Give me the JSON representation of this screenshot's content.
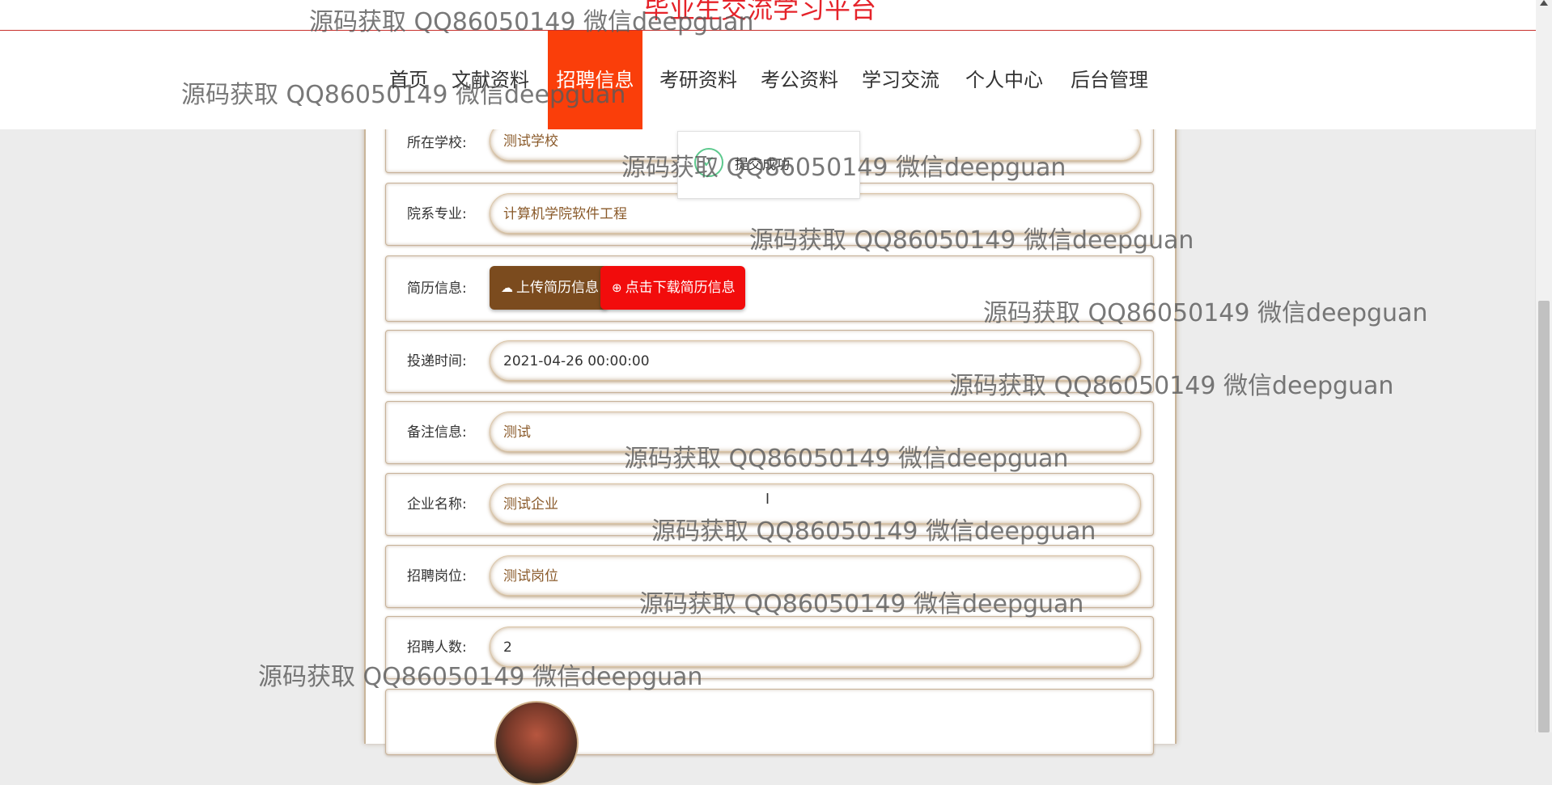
{
  "header": {
    "site_title": "毕业生交流学习平台",
    "nav": [
      {
        "label": "首页",
        "active": false
      },
      {
        "label": "文献资料",
        "active": false
      },
      {
        "label": "招聘信息",
        "active": true
      },
      {
        "label": "考研资料",
        "active": false
      },
      {
        "label": "考公资料",
        "active": false
      },
      {
        "label": "学习交流",
        "active": false
      },
      {
        "label": "个人中心",
        "active": false
      },
      {
        "label": "后台管理",
        "active": false
      }
    ],
    "accent_color": "#fa3e0a"
  },
  "form": {
    "school": {
      "label": "所在学校:",
      "value": "测试学校"
    },
    "major": {
      "label": "院系专业:",
      "value": "计算机学院软件工程"
    },
    "resume": {
      "label": "简历信息:",
      "upload_label": "上传简历信息",
      "download_label": "点击下载简历信息"
    },
    "submit_time": {
      "label": "投递时间:",
      "value": "2021-04-26 00:00:00"
    },
    "remark": {
      "label": "备注信息:",
      "value": "测试"
    },
    "company": {
      "label": "企业名称:",
      "value": "测试企业"
    },
    "position": {
      "label": "招聘岗位:",
      "value": "测试岗位"
    },
    "headcount": {
      "label": "招聘人数:",
      "value": "2"
    }
  },
  "toast": {
    "message": "提交成功",
    "icon": "check-circle-icon"
  },
  "watermark": "源码获取 QQ86050149 微信deepguan"
}
